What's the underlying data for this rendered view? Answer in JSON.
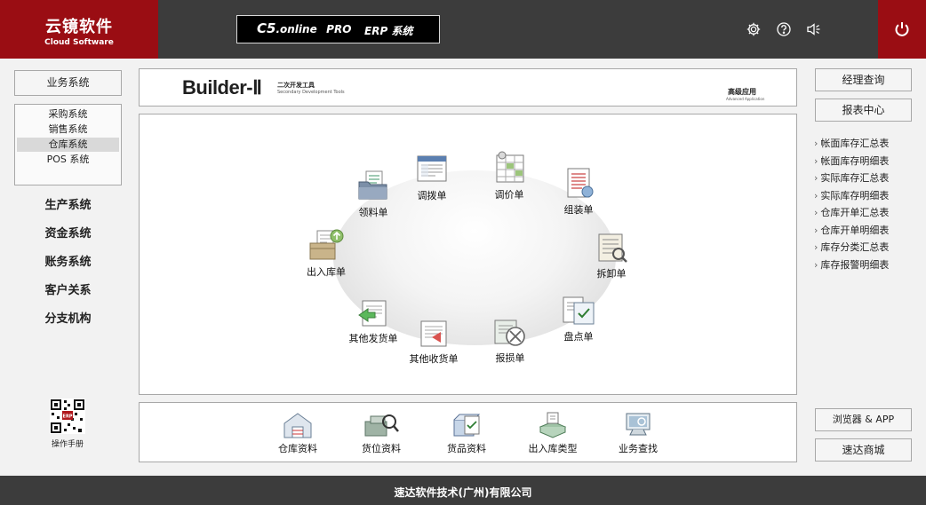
{
  "header": {
    "logo_cn": "云镜软件",
    "logo_en": "Cloud Software",
    "product_c5": "C5",
    "product_online": ".online",
    "product_pro": "PRO",
    "product_erp": "ERP 系统",
    "icons": [
      "gear-icon",
      "help-icon",
      "speaker-icon",
      "power-icon"
    ],
    "brand_color": "#9a0d13"
  },
  "left_nav": {
    "business_button": "业务系统",
    "sub_items": [
      {
        "label": "采购系统"
      },
      {
        "label": "销售系统"
      },
      {
        "label": "仓库系统",
        "active": true
      },
      {
        "label": "POS 系统"
      }
    ],
    "items": [
      {
        "label": "生产系统"
      },
      {
        "label": "资金系统"
      },
      {
        "label": "账务系统"
      },
      {
        "label": "客户关系"
      },
      {
        "label": "分支机构"
      }
    ],
    "manual_label": "操作手册"
  },
  "banner": {
    "title": "Builder-Ⅱ",
    "subtitle_cn": "二次开发工具",
    "subtitle_en": "Secondary Development Tools",
    "advanced_cn": "高级应用",
    "advanced_en": "Advanced Application"
  },
  "workflow": [
    {
      "label": "领料单",
      "icon": "folder-docs-icon"
    },
    {
      "label": "调拨单",
      "icon": "form-icon"
    },
    {
      "label": "调价单",
      "icon": "price-grid-icon"
    },
    {
      "label": "组装单",
      "icon": "assembly-list-icon"
    },
    {
      "label": "拆卸单",
      "icon": "disassembly-icon"
    },
    {
      "label": "盘点单",
      "icon": "inventory-check-icon"
    },
    {
      "label": "报损单",
      "icon": "damage-report-icon"
    },
    {
      "label": "其他收货单",
      "icon": "receive-icon"
    },
    {
      "label": "其他发货单",
      "icon": "ship-icon"
    },
    {
      "label": "出入库单",
      "icon": "inout-icon"
    }
  ],
  "bottom_tools": [
    {
      "label": "仓库资料",
      "icon": "warehouse-icon"
    },
    {
      "label": "货位资料",
      "icon": "location-icon"
    },
    {
      "label": "货品资料",
      "icon": "goods-icon"
    },
    {
      "label": "出入库类型",
      "icon": "inout-type-icon"
    },
    {
      "label": "业务查找",
      "icon": "search-icon"
    }
  ],
  "right_nav": {
    "manager_query": "经理查询",
    "report_center": "报表中心",
    "reports": [
      "帐面库存汇总表",
      "帐面库存明细表",
      "实际库存汇总表",
      "实际库存明细表",
      "仓库开单汇总表",
      "仓库开单明细表",
      "库存分类汇总表",
      "库存报警明细表"
    ],
    "browser_app": "浏览器 & APP",
    "mall": "速达商城"
  },
  "footer": {
    "company": "速达软件技术(广州)有限公司"
  }
}
